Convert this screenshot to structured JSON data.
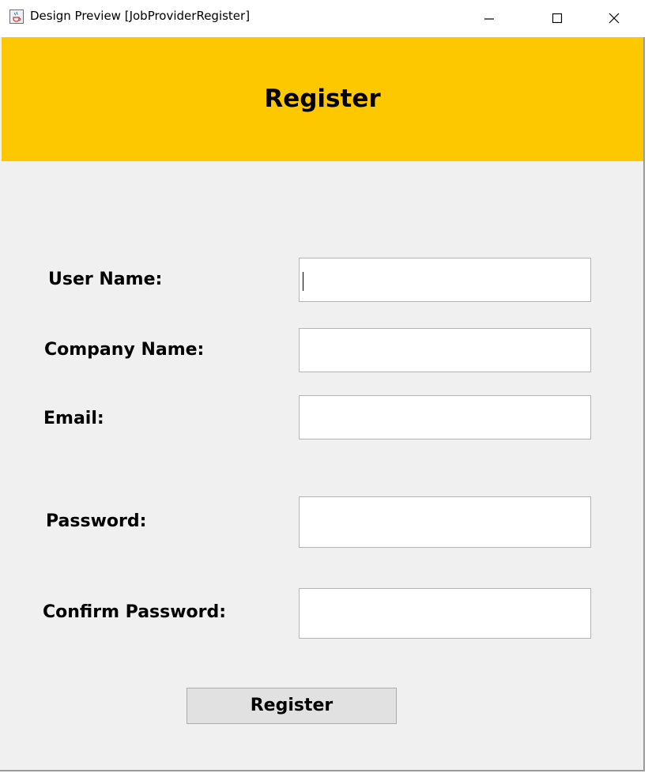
{
  "window": {
    "title": "Design Preview [JobProviderRegister]",
    "icon": "java-cup-icon",
    "controls": [
      "minimize-icon",
      "maximize-icon",
      "close-icon"
    ]
  },
  "header": {
    "title": "Register",
    "background_color": "#fdc800"
  },
  "form": {
    "user_name": {
      "label": "User Name:",
      "value": ""
    },
    "company_name": {
      "label": "Company Name:",
      "value": ""
    },
    "email": {
      "label": "Email:",
      "value": ""
    },
    "password": {
      "label": "Password:",
      "value": ""
    },
    "confirm_password": {
      "label": "Confirm Password:",
      "value": ""
    },
    "submit_label": "Register"
  }
}
